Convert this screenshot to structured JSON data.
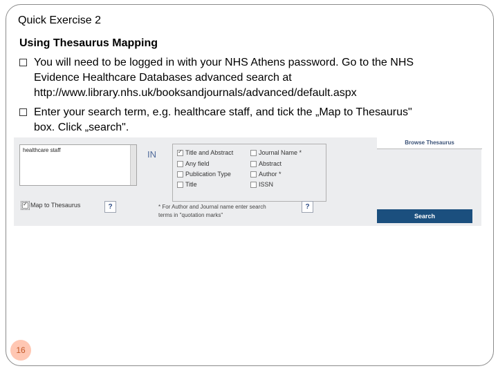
{
  "slide": {
    "title": "Quick Exercise 2",
    "subtitle": "Using Thesaurus Mapping",
    "bullets": [
      {
        "lines": [
          "You will need to be logged in with your NHS Athens password. Go to the NHS",
          "Evidence Healthcare Databases advanced search at",
          "http://www.library.nhs.uk/booksandjournals/advanced/default.aspx"
        ]
      },
      {
        "lines": [
          "Enter your search term, e.g. healthcare staff, and tick the „Map to Thesaurus\"",
          "box. Click „search\"."
        ]
      }
    ],
    "page_number": "16"
  },
  "search_form": {
    "search_term": "healthcare staff",
    "in_label": "IN",
    "fields_left": [
      {
        "label": "Title and Abstract",
        "checked": true
      },
      {
        "label": "Any field",
        "checked": false
      },
      {
        "label": "Publication Type",
        "checked": false
      },
      {
        "label": "Title",
        "checked": false
      }
    ],
    "fields_right": [
      {
        "label": "Journal Name *",
        "checked": false
      },
      {
        "label": "Abstract",
        "checked": false
      },
      {
        "label": "Author *",
        "checked": false
      },
      {
        "label": "ISSN",
        "checked": false
      }
    ],
    "browse_thesaurus": "Browse Thesaurus",
    "map_to_thesaurus": {
      "label": "Map to Thesaurus",
      "checked": true
    },
    "help_label": "?",
    "note_lines": [
      "* For Author and Journal name enter search",
      "terms in \"quotation marks\""
    ],
    "search_button": "Search"
  },
  "colors": {
    "search_button": "#1b4f7e",
    "page_badge": "#ffc7b3"
  }
}
